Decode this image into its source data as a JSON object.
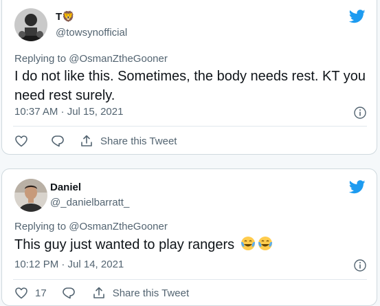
{
  "colors": {
    "twitter_blue": "#1d9bf0",
    "text_primary": "#0f1419",
    "text_secondary": "#536471",
    "border": "#cfd9de"
  },
  "tweets": [
    {
      "name": "T🦁",
      "handle": "@towsynofficial",
      "replying_prefix": "Replying to ",
      "replying_to": "@OsmanZtheGooner",
      "text": "I do not like this. Sometimes, the body needs rest. KT you need rest surely.",
      "timestamp": "10:37 AM · Jul 15, 2021",
      "like_count": "",
      "share_label": "Share this Tweet",
      "icons": {
        "avatar": "avatar-photo",
        "logo": "twitter-bird-icon",
        "info": "info-icon",
        "like": "heart-icon",
        "reply": "reply-bubble-icon",
        "share": "share-icon"
      }
    },
    {
      "name": "Daniel",
      "handle": "@_danielbarratt_",
      "replying_prefix": "Replying to ",
      "replying_to": "@OsmanZtheGooner",
      "text": "This guy just wanted to play rangers",
      "emojis": [
        "face-with-tears-of-joy",
        "face-with-tears-of-joy"
      ],
      "timestamp": "10:12 PM · Jul 14, 2021",
      "like_count": "17",
      "share_label": "Share this Tweet",
      "icons": {
        "avatar": "avatar-photo",
        "logo": "twitter-bird-icon",
        "info": "info-icon",
        "like": "heart-icon",
        "reply": "reply-bubble-icon",
        "share": "share-icon"
      }
    }
  ]
}
